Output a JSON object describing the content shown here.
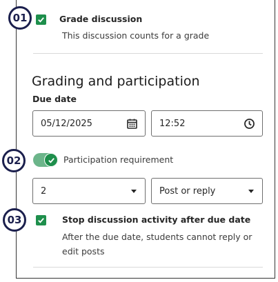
{
  "steps": {
    "one": "01",
    "two": "02",
    "three": "03"
  },
  "grade": {
    "checked": true,
    "label": "Grade discussion",
    "description": "This discussion counts for a grade"
  },
  "grading_section": {
    "title": "Grading and participation",
    "due_date_label": "Due date",
    "date_value": "05/12/2025",
    "time_value": "12:52"
  },
  "participation": {
    "enabled": true,
    "label": "Participation requirement",
    "count_value": "2",
    "type_value": "Post or reply"
  },
  "stop_activity": {
    "checked": true,
    "label": "Stop discussion activity after due date",
    "description_line1": "After the due date, students cannot reply or",
    "description_line2": "edit posts"
  },
  "colors": {
    "accent_green": "#1e8f4c",
    "toggle_track": "#6cb58a",
    "badge_navy": "#1b1f4d"
  }
}
